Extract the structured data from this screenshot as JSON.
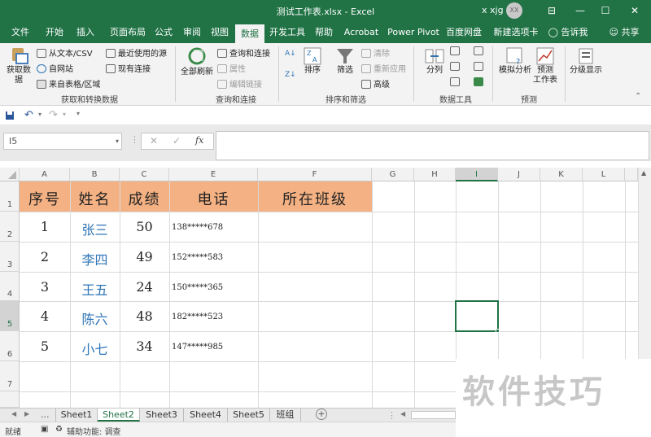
{
  "titlebar": {
    "title": "测试工作表.xlsx  -  Excel",
    "user": "x xjg",
    "avatar": "XX",
    "minimize": "—",
    "restore": "☐",
    "close": "✕",
    "ribbon_display": "⊟"
  },
  "tabs": [
    "文件",
    "开始",
    "插入",
    "页面布局",
    "公式",
    "审阅",
    "视图",
    "数据",
    "开发工具",
    "帮助",
    "Acrobat",
    "Power Pivot",
    "百度网盘",
    "新建选项卡"
  ],
  "tell_me": "告诉我",
  "share": "共享",
  "ribbon": {
    "get_data": {
      "big_label_1": "获取数",
      "big_label_2": "据",
      "from_text": "从文本/CSV",
      "from_web": "自网站",
      "from_table": "来自表格/区域",
      "recent_sources": "最近使用的源",
      "existing_connections": "现有连接",
      "group_label": "获取和转换数据"
    },
    "queries": {
      "refresh_1": "全部刷新",
      "queries_connections": "查询和连接",
      "properties": "属性",
      "edit_links": "编辑链接",
      "group_label": "查询和连接"
    },
    "sort_filter": {
      "sort": "排序",
      "filter": "筛选",
      "clear": "清除",
      "reapply": "重新应用",
      "advanced": "高级",
      "group_label": "排序和筛选"
    },
    "data_tools": {
      "text_to_columns": "分列",
      "group_label": "数据工具"
    },
    "forecast": {
      "what_if": "模拟分析",
      "forecast_1": "预测",
      "forecast_2": "工作表",
      "group_label": "预测"
    },
    "outline": {
      "label": "分级显示"
    }
  },
  "namebox": "I5",
  "fx": "fx",
  "columns": [
    "A",
    "B",
    "C",
    "E",
    "F",
    "G",
    "H",
    "I",
    "J",
    "K",
    "L"
  ],
  "rows": [
    "1",
    "2",
    "3",
    "4",
    "5",
    "6",
    "7"
  ],
  "table": {
    "headers": [
      "序号",
      "姓名",
      "成绩",
      "电话",
      "所在班级"
    ],
    "rows": [
      [
        "1",
        "张三",
        "50",
        "138*****678",
        ""
      ],
      [
        "2",
        "李四",
        "49",
        "152*****583",
        ""
      ],
      [
        "3",
        "王五",
        "24",
        "150*****365",
        ""
      ],
      [
        "4",
        "陈六",
        "48",
        "182*****523",
        ""
      ],
      [
        "5",
        "小七",
        "34",
        "147*****985",
        ""
      ]
    ]
  },
  "sheets": [
    "Sheet1",
    "Sheet2",
    "Sheet3",
    "Sheet4",
    "Sheet5",
    "班组"
  ],
  "active_sheet": "Sheet2",
  "sheet_nav_more": "...",
  "status": {
    "ready": "就绪",
    "accessibility": "辅助功能: 调查"
  },
  "watermark": "软件技巧",
  "colors": {
    "excel_green": "#217346",
    "header_fill": "#f4b183",
    "text_blue": "#2e75b6"
  }
}
